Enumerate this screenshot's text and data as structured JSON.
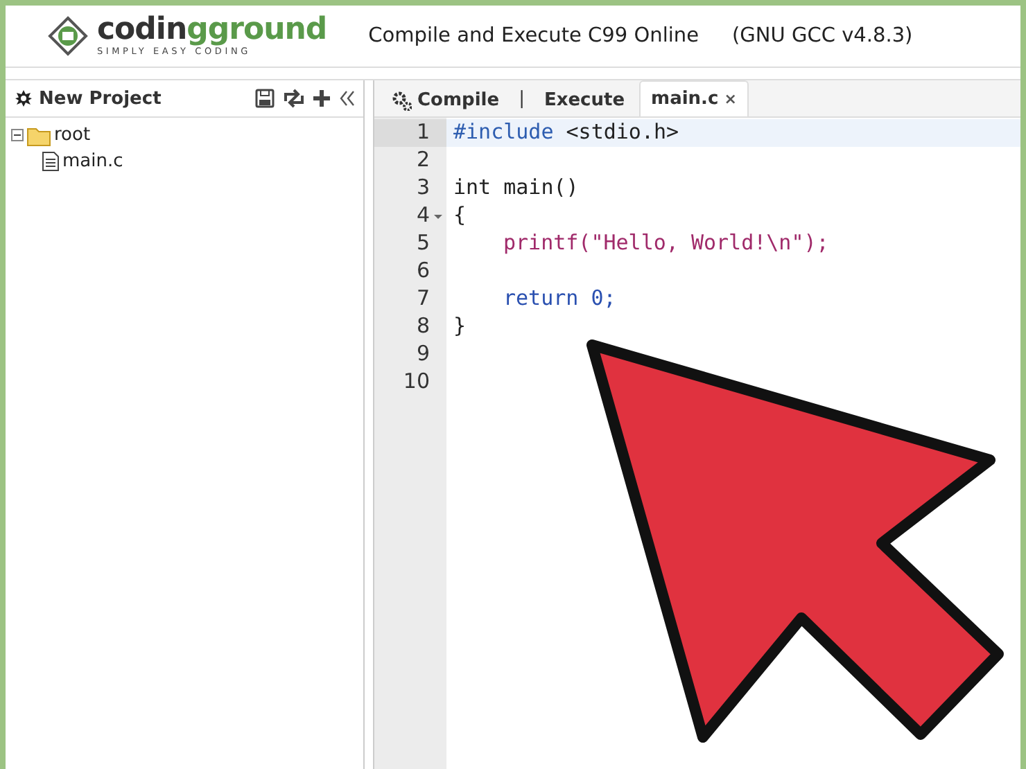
{
  "header": {
    "logo_name": "codingground",
    "logo_tagline": "SIMPLY EASY CODING",
    "title": "Compile and Execute C99 Online",
    "version": "(GNU GCC v4.8.3)"
  },
  "sidebar": {
    "title": "New Project",
    "tree": [
      {
        "label": "root",
        "kind": "folder",
        "expanded": true,
        "children": [
          {
            "label": "main.c",
            "kind": "file"
          }
        ]
      }
    ]
  },
  "toolbar": [
    {
      "kind": "button",
      "label": "Compile"
    },
    {
      "kind": "separator",
      "label": "|"
    },
    {
      "kind": "button",
      "label": "Execute"
    },
    {
      "kind": "file",
      "label": "main.c",
      "close": "×",
      "selected": true
    }
  ],
  "code_lines": [
    {
      "number": "1",
      "active": true,
      "fold": false,
      "tokens": [
        {
          "kind": "preproc",
          "text": "#include"
        },
        {
          "kind": "plain",
          "text": " <stdio.h>"
        }
      ]
    },
    {
      "number": "2",
      "active": false,
      "fold": false
    },
    {
      "number": "3",
      "active": false,
      "fold": false,
      "tokens": [
        {
          "kind": "plain",
          "text": "int main()"
        }
      ]
    },
    {
      "number": "4",
      "active": false,
      "fold": true,
      "tokens": [
        {
          "kind": "plain",
          "text": "{"
        }
      ]
    },
    {
      "number": "5",
      "active": false,
      "fold": false,
      "indented": true,
      "tokens": [
        {
          "kind": "string",
          "text": "printf(\"Hello, World!\\n\");"
        }
      ]
    },
    {
      "number": "6",
      "active": false,
      "fold": false
    },
    {
      "number": "7",
      "active": false,
      "fold": false,
      "indented": true,
      "tokens": [
        {
          "kind": "keyword",
          "text": "return 0;"
        }
      ]
    },
    {
      "number": "8",
      "active": false,
      "fold": false,
      "tokens": [
        {
          "kind": "plain",
          "text": "}"
        }
      ]
    },
    {
      "number": "9",
      "active": false,
      "fold": false
    },
    {
      "number": "10",
      "active": false,
      "fold": false
    }
  ]
}
